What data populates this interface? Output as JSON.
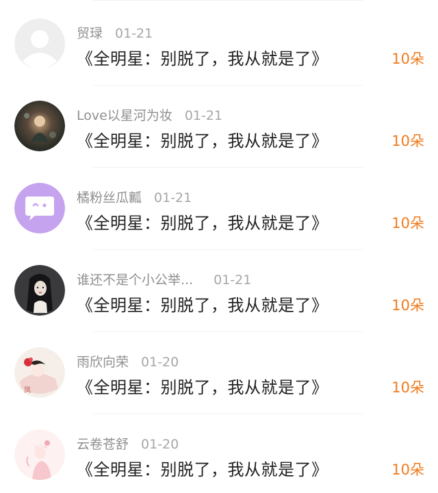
{
  "list": {
    "items": [
      {
        "name": "贸琭",
        "date": "01-21",
        "gift": "《全明星：别脱了，我从就是了》",
        "count": "10朵",
        "avatar": "default-person-icon"
      },
      {
        "name": "Love以星河为妆",
        "date": "01-21",
        "gift": "《全明星：别脱了，我从就是了》",
        "count": "10朵",
        "avatar": "dark-fantasy-art"
      },
      {
        "name": "橘粉丝瓜瓤",
        "date": "01-21",
        "gift": "《全明星：别脱了，我从就是了》",
        "count": "10朵",
        "avatar": "purple-chat-face"
      },
      {
        "name": "谁还不是个小公举...",
        "date": "01-21",
        "gift": "《全明星：别脱了，我从就是了》",
        "count": "10朵",
        "avatar": "dark-girl-illustration"
      },
      {
        "name": "雨欣向荣",
        "date": "01-20",
        "gift": "《全明星：别脱了，我从就是了》",
        "count": "10朵",
        "avatar": "girl-with-red-flower"
      },
      {
        "name": "云卷苍舒",
        "date": "01-20",
        "gift": "《全明星：别脱了，我从就是了》",
        "count": "10朵",
        "avatar": "pink-girl-illustration"
      }
    ]
  },
  "colors": {
    "count_orange": "#f07a1c",
    "meta_gray": "#9a9a9a",
    "text_dark": "#222222"
  }
}
